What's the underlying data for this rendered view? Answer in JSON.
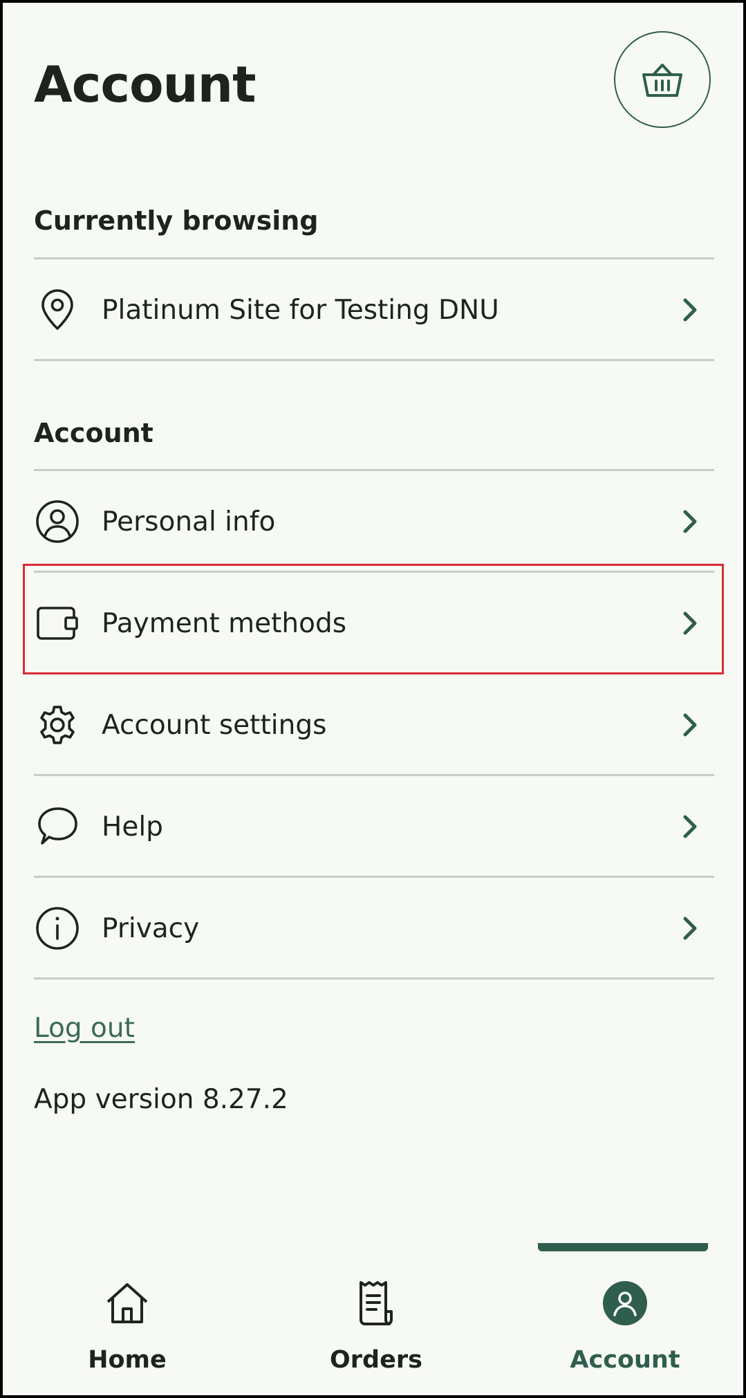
{
  "header": {
    "title": "Account",
    "basket_icon": "basket-icon"
  },
  "browsing": {
    "section_title": "Currently browsing",
    "site": {
      "label": "Platinum Site for Testing DNU",
      "icon": "location-pin-icon"
    }
  },
  "account": {
    "section_title": "Account",
    "items": [
      {
        "label": "Personal info",
        "icon": "user-circle-icon"
      },
      {
        "label": "Payment methods",
        "icon": "wallet-icon"
      },
      {
        "label": "Account settings",
        "icon": "gear-icon"
      },
      {
        "label": "Help",
        "icon": "chat-bubble-icon"
      },
      {
        "label": "Privacy",
        "icon": "info-icon"
      }
    ]
  },
  "logout_label": "Log out",
  "app_version": "App version 8.27.2",
  "bottom_nav": {
    "active": "Account",
    "items": [
      {
        "label": "Home",
        "icon": "home-icon"
      },
      {
        "label": "Orders",
        "icon": "receipt-icon"
      },
      {
        "label": "Account",
        "icon": "account-icon"
      }
    ]
  },
  "colors": {
    "accent": "#2f5e4e",
    "background": "#f7f9f4",
    "highlight": "#d92c35",
    "divider": "#c9ccc6"
  }
}
